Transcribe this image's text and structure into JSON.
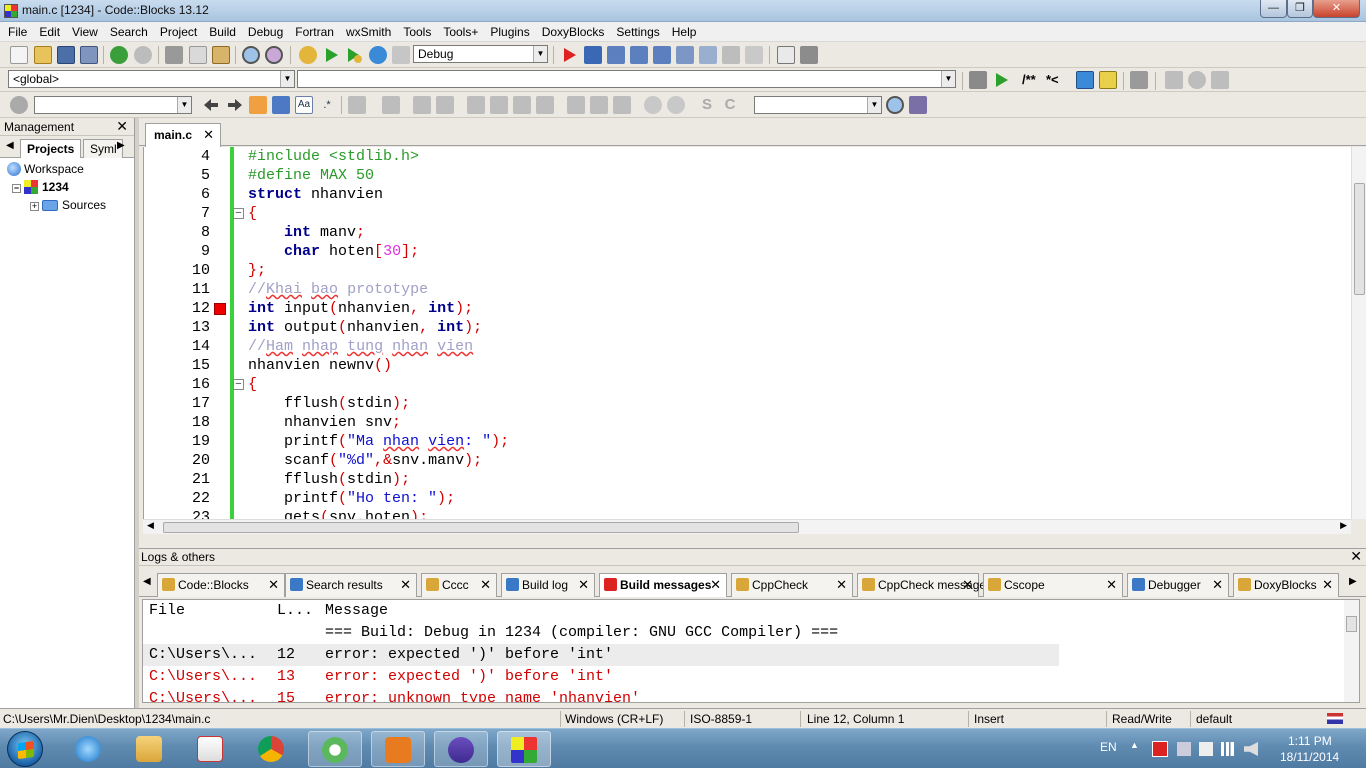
{
  "window": {
    "title": "main.c [1234] - Code::Blocks 13.12"
  },
  "menu": [
    "File",
    "Edit",
    "View",
    "Search",
    "Project",
    "Build",
    "Debug",
    "Fortran",
    "wxSmith",
    "Tools",
    "Tools+",
    "Plugins",
    "DoxyBlocks",
    "Settings",
    "Help"
  ],
  "toolbar": {
    "build_target": "Debug",
    "scope": "<global>",
    "function": "",
    "doxy_comment": "/**",
    "doxy_line": "*<",
    "search_input": "",
    "find_combo": ""
  },
  "management": {
    "title": "Management",
    "tabs": [
      "Projects",
      "Syml"
    ],
    "tree": {
      "workspace": "Workspace",
      "project": "1234",
      "folder": "Sources"
    }
  },
  "editor": {
    "tab": "main.c",
    "breakpoint_line": 12,
    "lines": [
      {
        "n": "4",
        "text": "#include <stdlib.h>"
      },
      {
        "n": "5",
        "text": "#define MAX 50"
      },
      {
        "n": "6",
        "text": "struct nhanvien"
      },
      {
        "n": "7",
        "text": "{"
      },
      {
        "n": "8",
        "text": "    int manv;"
      },
      {
        "n": "9",
        "text": "    char hoten[30];"
      },
      {
        "n": "10",
        "text": "};"
      },
      {
        "n": "11",
        "text": "//Khai bao prototype"
      },
      {
        "n": "12",
        "text": "int input(nhanvien, int);"
      },
      {
        "n": "13",
        "text": "int output(nhanvien, int);"
      },
      {
        "n": "14",
        "text": "//Ham nhap tung nhan vien"
      },
      {
        "n": "15",
        "text": "nhanvien newnv()"
      },
      {
        "n": "16",
        "text": "{"
      },
      {
        "n": "17",
        "text": "    fflush(stdin);"
      },
      {
        "n": "18",
        "text": "    nhanvien snv;"
      },
      {
        "n": "19",
        "text": "    printf(\"Ma nhan vien: \");"
      },
      {
        "n": "20",
        "text": "    scanf(\"%d\",&snv.manv);"
      },
      {
        "n": "21",
        "text": "    fflush(stdin);"
      },
      {
        "n": "22",
        "text": "    printf(\"Ho ten: \");"
      },
      {
        "n": "23",
        "text": "    gets(snv.hoten);"
      }
    ]
  },
  "logs": {
    "title": "Logs & others",
    "tabs": [
      "Code::Blocks",
      "Search results",
      "Cccc",
      "Build log",
      "Build messages",
      "CppCheck",
      "CppCheck messages",
      "Cscope",
      "Debugger",
      "DoxyBlocks"
    ],
    "active_tab": "Build messages",
    "columns": [
      "File",
      "L...",
      "Message"
    ],
    "rows": [
      {
        "file": "",
        "line": "",
        "message": "=== Build: Debug in 1234 (compiler: GNU GCC Compiler) ==="
      },
      {
        "file": "C:\\Users\\...",
        "line": "12",
        "message": "error: expected ')' before 'int'"
      },
      {
        "file": "C:\\Users\\...",
        "line": "13",
        "message": "error: expected ')' before 'int'"
      },
      {
        "file": "C:\\Users\\...",
        "line": "15",
        "message": "error: unknown type name 'nhanvien'"
      }
    ]
  },
  "status": {
    "path": "C:\\Users\\Mr.Dien\\Desktop\\1234\\main.c",
    "eol": "Windows (CR+LF)",
    "encoding": "ISO-8859-1",
    "position": "Line 12, Column 1",
    "mode": "Insert",
    "access": "Read/Write",
    "profile": "default"
  },
  "taskbar": {
    "language": "EN",
    "time": "1:11 PM",
    "date": "18/11/2014"
  },
  "colors": {
    "keyword": "#00008b",
    "preprocessor": "#2a9a2a",
    "comment": "#a0a0c8",
    "error_text": "#d00000",
    "change_bar": "#3ad13a",
    "breakpoint": "#e00000"
  }
}
